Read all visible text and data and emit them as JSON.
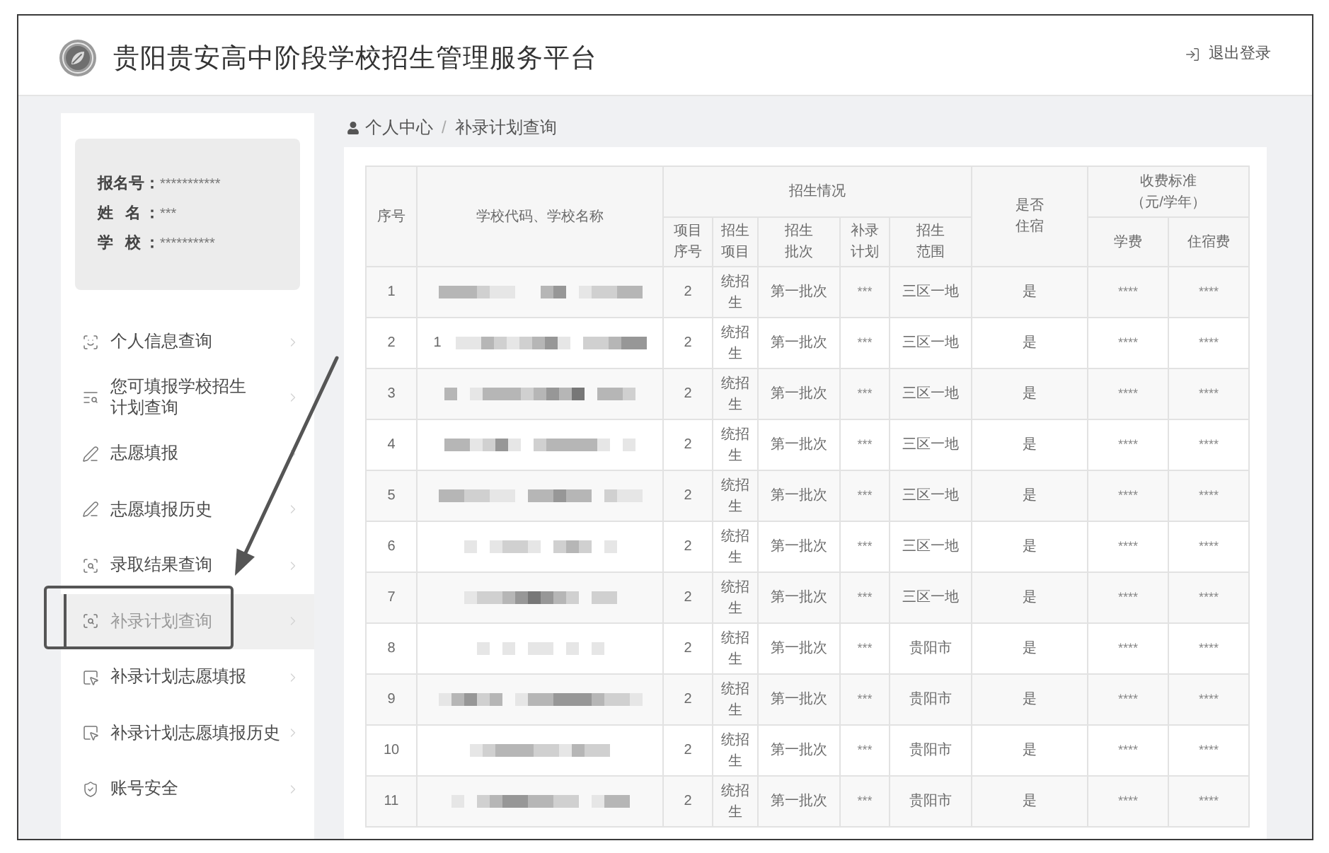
{
  "header": {
    "title": "贵阳贵安高中阶段学校招生管理服务平台",
    "logout": "退出登录"
  },
  "profile": [
    {
      "label": "报名号：",
      "value": "***********"
    },
    {
      "label": "姓 名：",
      "value": "***"
    },
    {
      "label": "学 校：",
      "value": "**********"
    }
  ],
  "menu": [
    {
      "label": "个人信息查询",
      "selected": false
    },
    {
      "label": "您可填报学校招生计划查询",
      "selected": false
    },
    {
      "label": "志愿填报",
      "selected": false
    },
    {
      "label": "志愿填报历史",
      "selected": false
    },
    {
      "label": "录取结果查询",
      "selected": false
    },
    {
      "label": "补录计划查询",
      "selected": true
    },
    {
      "label": "补录计划志愿填报",
      "selected": false
    },
    {
      "label": "补录计划志愿填报历史",
      "selected": false
    },
    {
      "label": "账号安全",
      "selected": false
    }
  ],
  "breadcrumb": {
    "items": [
      "个人中心",
      "补录计划查询"
    ],
    "separator": "/"
  },
  "table": {
    "columns": [
      {
        "label": "序号"
      },
      {
        "label": "学校代码、学校名称"
      },
      {
        "label": "招生情况",
        "children": [
          {
            "label": "项目序号"
          },
          {
            "label": "招生项目"
          },
          {
            "label": "招生批次"
          },
          {
            "label": "补录计划"
          },
          {
            "label": "招生范围"
          }
        ]
      },
      {
        "label": "是否住宿"
      },
      {
        "label": "收费标准（元/学年）",
        "children": [
          {
            "label": "学费"
          },
          {
            "label": "住宿费"
          }
        ]
      }
    ],
    "rows": [
      {
        "no": "1",
        "item_no": "2",
        "item": "统招生",
        "batch": "第一批次",
        "supplement": "***",
        "scope": "三区一地",
        "boarding": "是",
        "tuition": "****",
        "lodging_fee": "****"
      },
      {
        "no": "2",
        "school_text": "1",
        "item_no": "2",
        "item": "统招生",
        "batch": "第一批次",
        "supplement": "***",
        "scope": "三区一地",
        "boarding": "是",
        "tuition": "****",
        "lodging_fee": "****"
      },
      {
        "no": "3",
        "item_no": "2",
        "item": "统招生",
        "batch": "第一批次",
        "supplement": "***",
        "scope": "三区一地",
        "boarding": "是",
        "tuition": "****",
        "lodging_fee": "****"
      },
      {
        "no": "4",
        "item_no": "2",
        "item": "统招生",
        "batch": "第一批次",
        "supplement": "***",
        "scope": "三区一地",
        "boarding": "是",
        "tuition": "****",
        "lodging_fee": "****"
      },
      {
        "no": "5",
        "item_no": "2",
        "item": "统招生",
        "batch": "第一批次",
        "supplement": "***",
        "scope": "三区一地",
        "boarding": "是",
        "tuition": "****",
        "lodging_fee": "****"
      },
      {
        "no": "6",
        "item_no": "2",
        "item": "统招生",
        "batch": "第一批次",
        "supplement": "***",
        "scope": "三区一地",
        "boarding": "是",
        "tuition": "****",
        "lodging_fee": "****"
      },
      {
        "no": "7",
        "item_no": "2",
        "item": "统招生",
        "batch": "第一批次",
        "supplement": "***",
        "scope": "三区一地",
        "boarding": "是",
        "tuition": "****",
        "lodging_fee": "****"
      },
      {
        "no": "8",
        "item_no": "2",
        "item": "统招生",
        "batch": "第一批次",
        "supplement": "***",
        "scope": "贵阳市",
        "boarding": "是",
        "tuition": "****",
        "lodging_fee": "****"
      },
      {
        "no": "9",
        "item_no": "2",
        "item": "统招生",
        "batch": "第一批次",
        "supplement": "***",
        "scope": "贵阳市",
        "boarding": "是",
        "tuition": "****",
        "lodging_fee": "****"
      },
      {
        "no": "10",
        "item_no": "2",
        "item": "统招生",
        "batch": "第一批次",
        "supplement": "***",
        "scope": "贵阳市",
        "boarding": "是",
        "tuition": "****",
        "lodging_fee": "****"
      },
      {
        "no": "11",
        "item_no": "2",
        "item": "统招生",
        "batch": "第一批次",
        "supplement": "***",
        "scope": "贵阳市",
        "boarding": "是",
        "tuition": "****",
        "lodging_fee": "****"
      }
    ]
  }
}
